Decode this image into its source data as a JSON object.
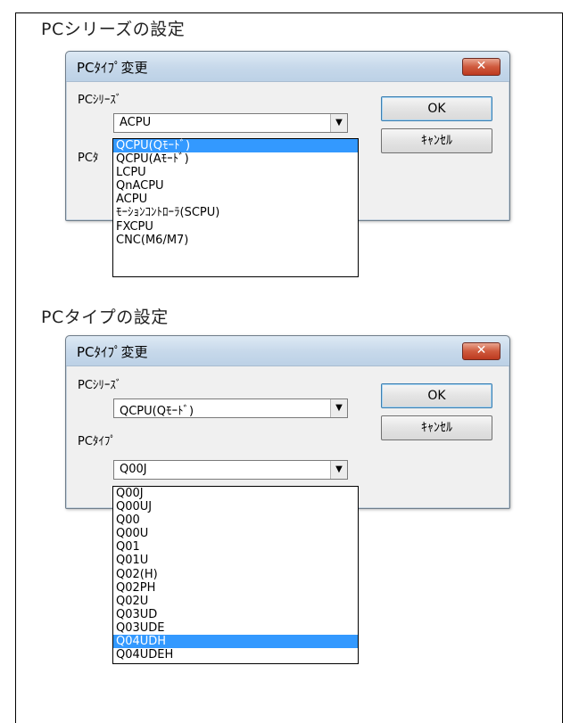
{
  "section1": {
    "heading": "PCシリーズの設定",
    "dialog": {
      "title": "PCﾀｲﾌﾟ変更",
      "close_label": "✕",
      "series_label": "PCｼﾘｰｽﾞ",
      "series_value": "ACPU",
      "type_label_partial": "PCﾀ",
      "ok_label": "OK",
      "cancel_label": "ｷｬﾝｾﾙ",
      "dropdown_items": [
        "QCPU(Qﾓｰﾄﾞ)",
        "QCPU(Aﾓｰﾄﾞ)",
        "LCPU",
        "QnACPU",
        "ACPU",
        "ﾓｰｼｮﾝｺﾝﾄﾛｰﾗ(SCPU)",
        "FXCPU",
        "CNC(M6/M7)"
      ],
      "dropdown_selected": "QCPU(Qﾓｰﾄﾞ)"
    }
  },
  "section2": {
    "heading": "PCタイプの設定",
    "dialog": {
      "title": "PCﾀｲﾌﾟ変更",
      "close_label": "✕",
      "series_label": "PCｼﾘｰｽﾞ",
      "series_value": "QCPU(Qﾓｰﾄﾞ)",
      "type_label": "PCﾀｲﾌﾟ",
      "type_value": "Q00J",
      "ok_label": "OK",
      "cancel_label": "ｷｬﾝｾﾙ",
      "dropdown_items": [
        "Q00J",
        "Q00UJ",
        "Q00",
        "Q00U",
        "Q01",
        "Q01U",
        "Q02(H)",
        "Q02PH",
        "Q02U",
        "Q03UD",
        "Q03UDE",
        "Q04UDH",
        "Q04UDEH"
      ],
      "dropdown_selected": "Q04UDH"
    }
  },
  "icons": {
    "dropdown_arrow": "▼"
  }
}
